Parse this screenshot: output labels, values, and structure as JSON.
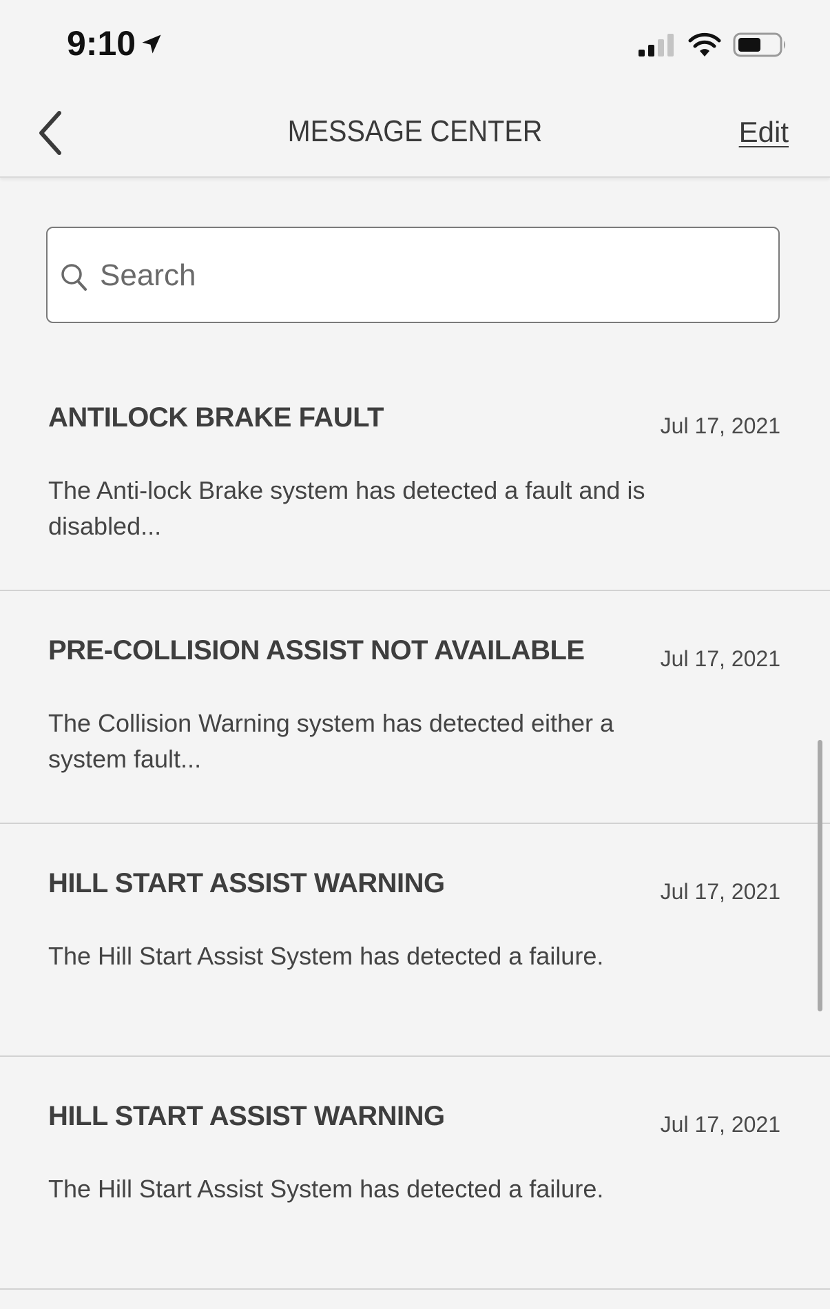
{
  "status_bar": {
    "time": "9:10"
  },
  "nav": {
    "title": "MESSAGE CENTER",
    "edit_label": "Edit"
  },
  "search": {
    "placeholder": "Search",
    "value": ""
  },
  "messages": [
    {
      "title": "ANTILOCK BRAKE FAULT",
      "date": "Jul 17, 2021",
      "body": "The Anti-lock Brake system has detected a fault and is disabled..."
    },
    {
      "title": "PRE-COLLISION ASSIST NOT AVAILABLE",
      "date": "Jul 17, 2021",
      "body": "The Collision Warning system has detected either a system fault..."
    },
    {
      "title": "HILL START ASSIST WARNING",
      "date": "Jul 17, 2021",
      "body": "The Hill Start Assist System has detected a failure."
    },
    {
      "title": "HILL START ASSIST WARNING",
      "date": "Jul 17, 2021",
      "body": "The Hill Start Assist System has detected a failure."
    }
  ],
  "icons": {
    "location": "location-arrow-icon",
    "signal": "cellular-signal-icon",
    "wifi": "wifi-icon",
    "battery": "battery-icon",
    "back": "chevron-left-icon",
    "search": "search-icon"
  },
  "colors": {
    "background": "#f4f4f4",
    "text": "#3c3c3c",
    "divider": "#d2d2d2"
  }
}
